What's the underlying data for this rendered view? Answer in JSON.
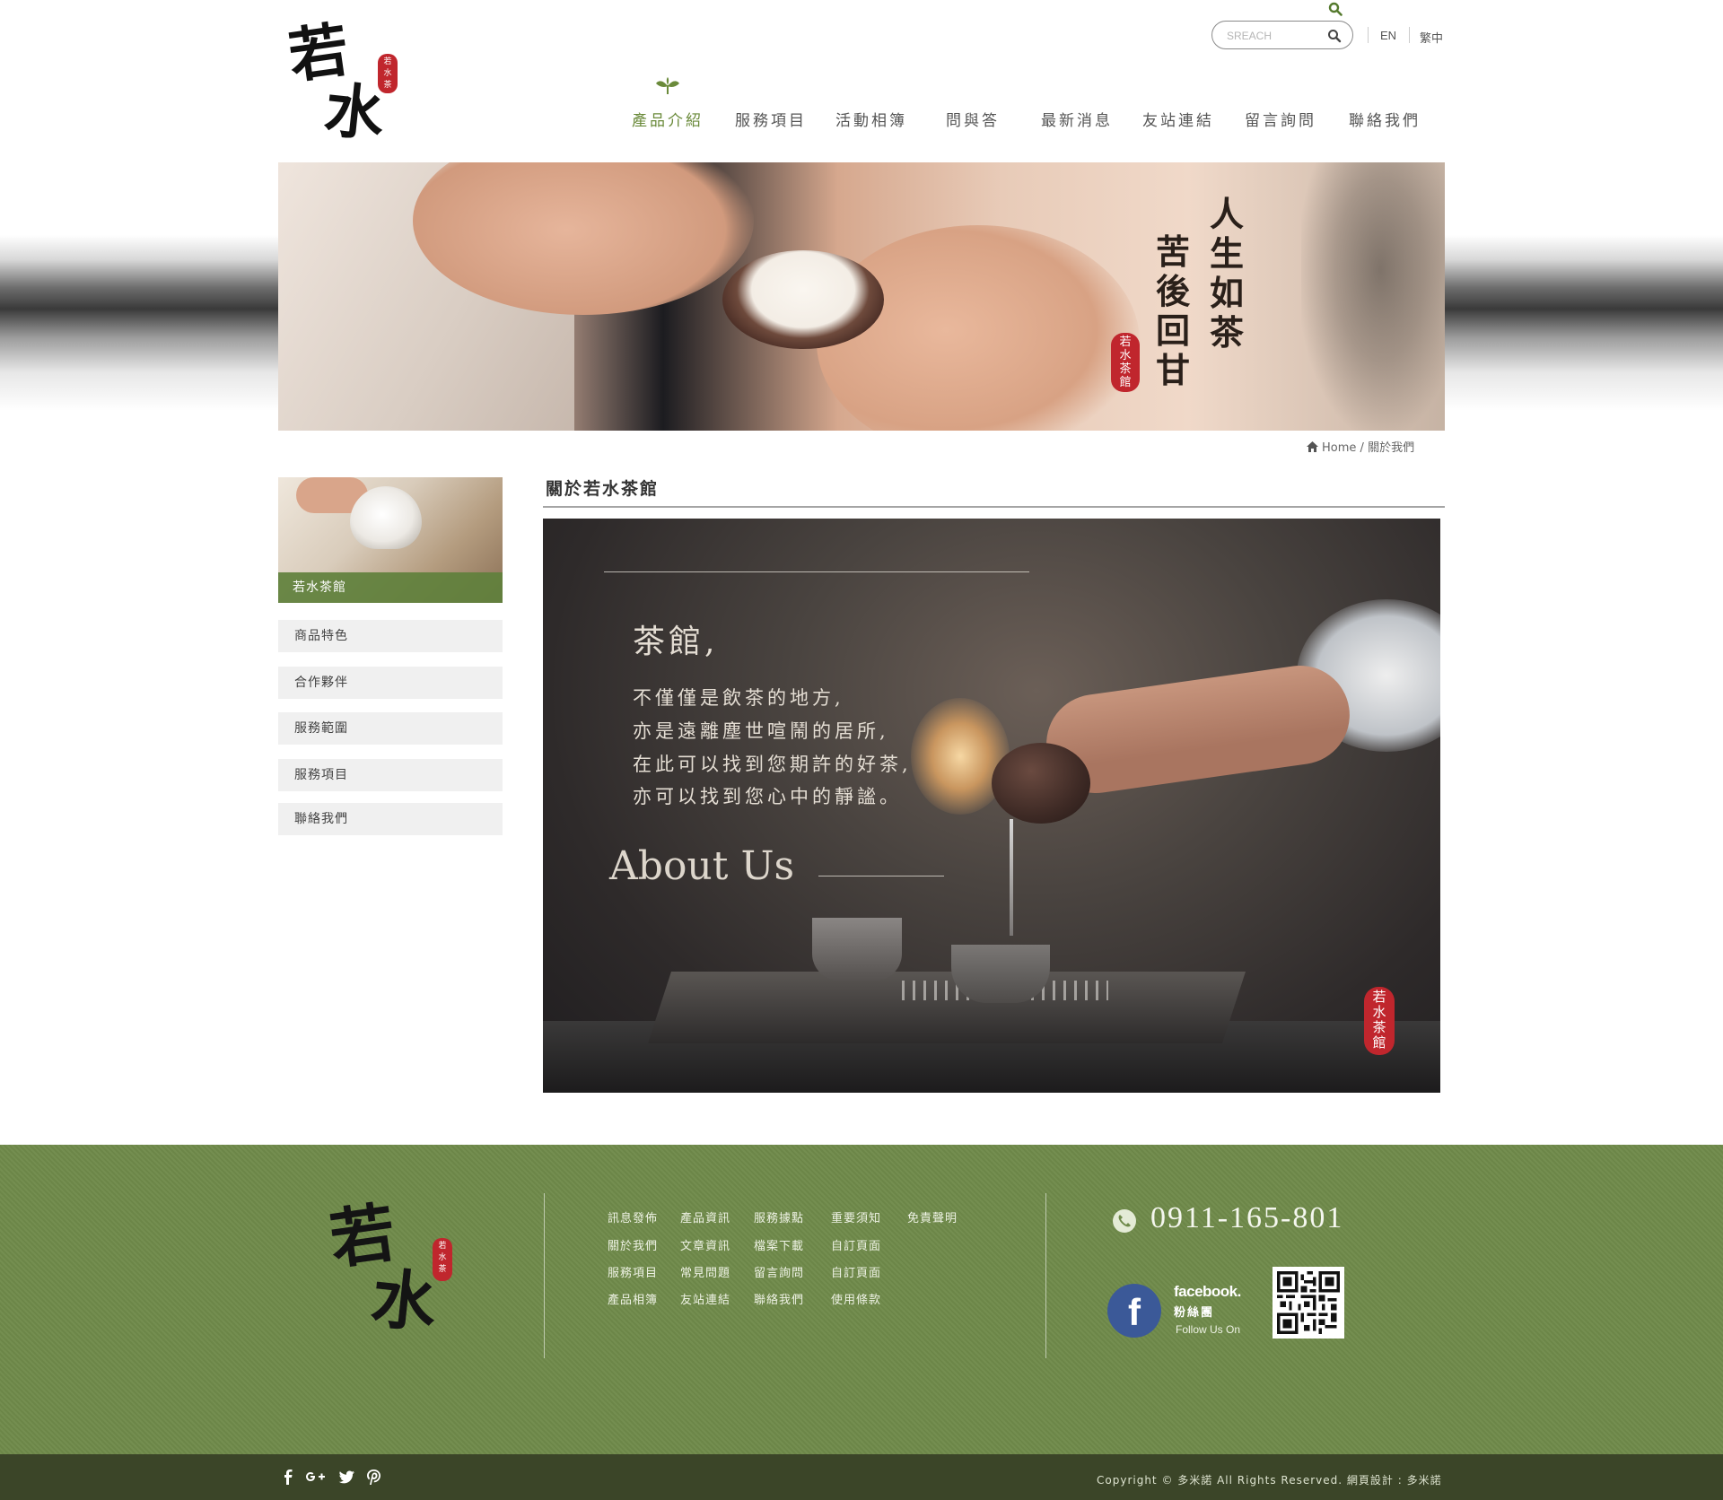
{
  "brand": {
    "logo_chars": [
      "若",
      "水"
    ],
    "seal_chars": [
      "若",
      "水",
      "茶",
      "館"
    ]
  },
  "header": {
    "search_placeholder": "SREACH",
    "lang_en": "EN",
    "lang_zh": "繁中"
  },
  "nav": {
    "items": [
      {
        "label": "產品介紹",
        "active": true
      },
      {
        "label": "服務項目"
      },
      {
        "label": "活動相簿"
      },
      {
        "label": "問與答"
      },
      {
        "label": "最新消息"
      },
      {
        "label": "友站連結"
      },
      {
        "label": "留言詢問"
      },
      {
        "label": "聯絡我們"
      }
    ]
  },
  "banner": {
    "poem_col1": "人生如茶",
    "poem_col2": "苦後回甘"
  },
  "breadcrumb": {
    "home": "Home",
    "separator": "/",
    "current": "關於我們"
  },
  "sidebar": {
    "photo_caption": "若水茶館",
    "items": [
      "商品特色",
      "合作夥伴",
      "服務範圍",
      "服務項目",
      "聯絡我們"
    ]
  },
  "content": {
    "title": "關於若水茶館",
    "heading": "茶館,",
    "lines": [
      "不僅僅是飲茶的地方,",
      "亦是遠離塵世喧鬧的居所,",
      "在此可以找到您期許的好茶,",
      "亦可以找到您心中的靜謐。"
    ],
    "about_label": "About Us"
  },
  "footer": {
    "links": [
      [
        "訊息發佈",
        "產品資訊",
        "服務據點",
        "重要須知",
        "免責聲明"
      ],
      [
        "關於我們",
        "文章資訊",
        "檔案下載",
        "自訂頁面"
      ],
      [
        "服務項目",
        "常見問題",
        "留言詢問",
        "自訂頁面"
      ],
      [
        "產品相簿",
        "友站連結",
        "聯絡我們",
        "使用條款"
      ]
    ],
    "phone": "0911-165-801",
    "facebook_word": "facebook.",
    "facebook_sub": "粉絲團",
    "follow": "Follow Us On",
    "copyright": "Copyright © 多米諾 All Rights Reserved.   網頁設計 : 多米諾"
  },
  "colors": {
    "accent_green": "#6f8a4a",
    "dark_green": "#3b4528",
    "seal_red": "#c0262d",
    "facebook_blue": "#3b5998"
  },
  "icons": [
    "search-icon",
    "home-icon",
    "leaf-icon",
    "phone-icon",
    "facebook-icon",
    "google-plus-icon",
    "twitter-icon",
    "pinterest-icon",
    "qr-code"
  ]
}
